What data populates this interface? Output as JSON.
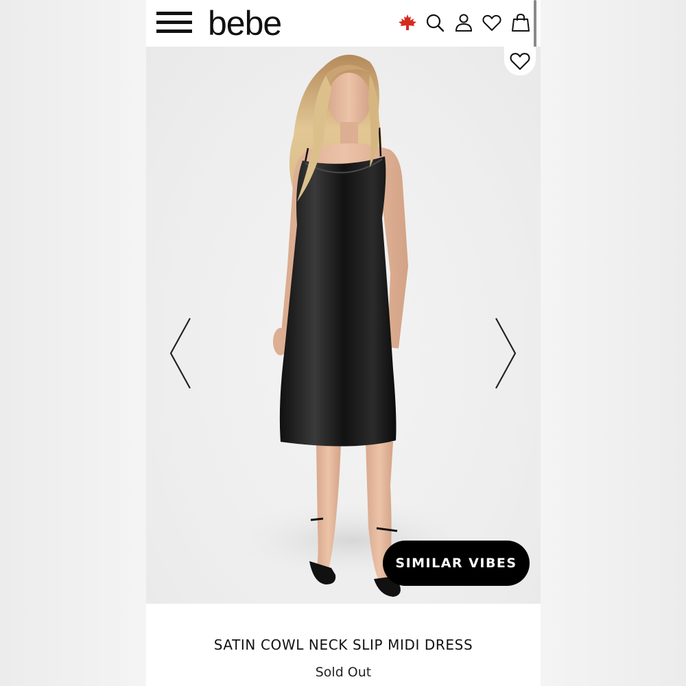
{
  "header": {
    "brand": "bebe",
    "icons": [
      "menu-icon",
      "canada-flag-icon",
      "search-icon",
      "account-icon",
      "heart-icon",
      "shopping-bag-icon"
    ]
  },
  "product": {
    "image_description_icon": "model-photo",
    "carousel": {
      "prev_icon": "chevron-left-icon",
      "next_icon": "chevron-right-icon"
    },
    "similar_button_label": "SIMILAR VIBES",
    "title": "SATIN COWL NECK SLIP MIDI DRESS",
    "status": "Sold Out"
  },
  "colors": {
    "brand_black": "#000000",
    "flag_red": "#d52b1e",
    "background": "#f6f6f6"
  }
}
